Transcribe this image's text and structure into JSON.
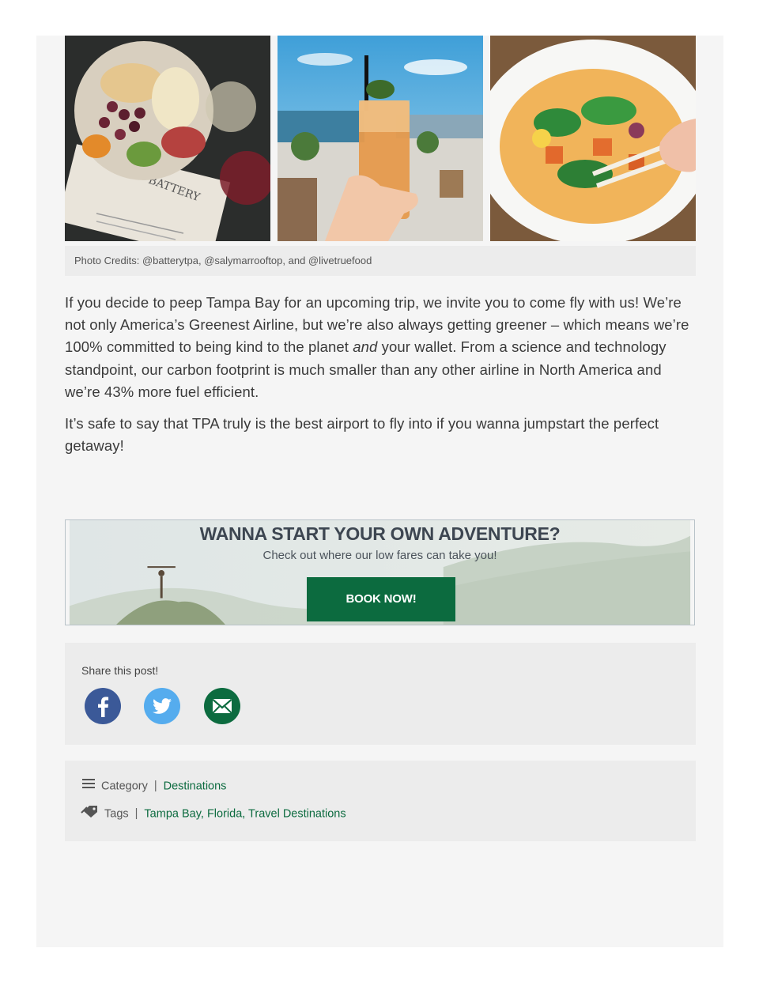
{
  "photos": {
    "items": [
      {
        "name": "charcuterie-board-photo",
        "menu_text": "BATTERY"
      },
      {
        "name": "rooftop-cocktail-photo"
      },
      {
        "name": "curry-bowl-photo"
      }
    ],
    "credits": "Photo Credits: @batterytpa, @salymarrooftop, and @livetruefood"
  },
  "article": {
    "p1_a": "If you decide to peep Tampa Bay for an upcoming trip, we invite you to come fly with us! We’re not only America’s Greenest Airline, but we’re also always getting greener – which means we’re 100% committed to being kind to the planet ",
    "p1_em": "and",
    "p1_b": " your wallet. From a science and technology standpoint, our carbon footprint is much smaller than any other airline in North America and we’re 43% more fuel efficient.",
    "p2": "It’s safe to say that TPA truly is the best airport to fly into if you wanna jumpstart the perfect getaway!"
  },
  "banner": {
    "title": "WANNA START YOUR OWN ADVENTURE?",
    "subtitle": "Check out where our low fares can take you!",
    "button": "BOOK NOW!",
    "button_color": "#0c6b3f"
  },
  "share": {
    "label": "Share this post!",
    "icons": [
      "facebook-icon",
      "twitter-icon",
      "email-icon"
    ],
    "colors": {
      "facebook": "#3b5998",
      "twitter": "#55acee",
      "email": "#0c6b3f"
    }
  },
  "meta": {
    "category_label": "Category",
    "category_value": "Destinations",
    "tags_label": "Tags",
    "tags_value": "Tampa Bay, Florida, Travel Destinations",
    "separator": "|",
    "link_color": "#0c6b3f"
  }
}
